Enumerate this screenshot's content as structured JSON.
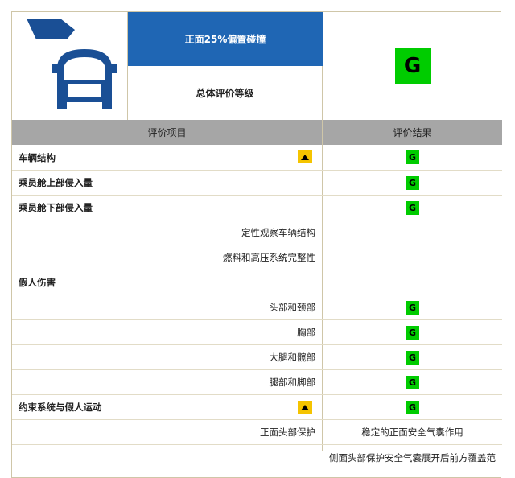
{
  "header": {
    "test_name": "正面25%偏置碰撞",
    "overall_label": "总体评价等级",
    "overall_grade": "G",
    "illustration_icon": "car-offset-crash-icon"
  },
  "columns": {
    "item": "评价项目",
    "result": "评价结果"
  },
  "rows": [
    {
      "label": "车辆结构",
      "style": "bold",
      "warning": true,
      "result_type": "grade",
      "result": "G"
    },
    {
      "label": "乘员舱上部侵入量",
      "style": "bold",
      "warning": false,
      "result_type": "grade",
      "result": "G"
    },
    {
      "label": "乘员舱下部侵入量",
      "style": "bold",
      "warning": false,
      "result_type": "grade",
      "result": "G"
    },
    {
      "label": "定性观察车辆结构",
      "style": "sub",
      "warning": false,
      "result_type": "text",
      "result": "——"
    },
    {
      "label": "燃料和高压系统完整性",
      "style": "sub",
      "warning": false,
      "result_type": "text",
      "result": "——"
    },
    {
      "label": "假人伤害",
      "style": "bold",
      "warning": false,
      "result_type": "none",
      "result": ""
    },
    {
      "label": "头部和颈部",
      "style": "sub",
      "warning": false,
      "result_type": "grade",
      "result": "G"
    },
    {
      "label": "胸部",
      "style": "sub",
      "warning": false,
      "result_type": "grade",
      "result": "G"
    },
    {
      "label": "大腿和髋部",
      "style": "sub",
      "warning": false,
      "result_type": "grade",
      "result": "G"
    },
    {
      "label": "腿部和脚部",
      "style": "sub",
      "warning": false,
      "result_type": "grade",
      "result": "G"
    },
    {
      "label": "约束系统与假人运动",
      "style": "bold",
      "warning": true,
      "result_type": "grade",
      "result": "G"
    },
    {
      "label": "正面头部保护",
      "style": "sub",
      "warning": false,
      "result_type": "text",
      "result": "稳定的正面安全气囊作用"
    },
    {
      "label": "",
      "style": "sub",
      "warning": false,
      "result_type": "text",
      "result": "侧面头部保护安全气囊展开后前方覆盖范"
    }
  ],
  "colors": {
    "header_blue": "#1f66b4",
    "grade_green": "#00cc00",
    "warning_yellow": "#f5c400",
    "column_header_gray": "#a6a6a6"
  }
}
